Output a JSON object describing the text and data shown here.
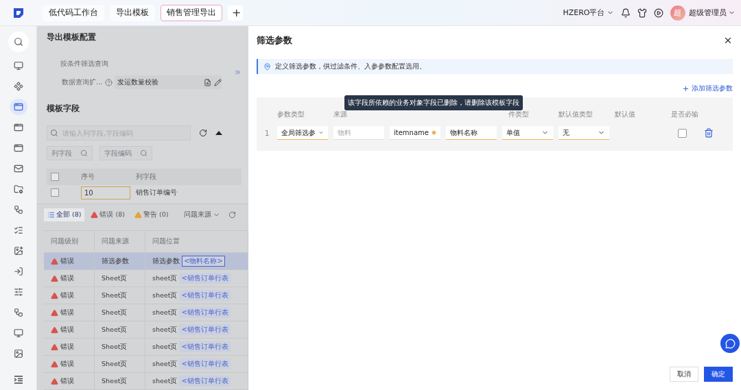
{
  "top_bar": {
    "tabs": [
      {
        "label": "低代码工作台",
        "selected": false
      },
      {
        "label": "导出模板",
        "selected": false
      },
      {
        "label": "销售管理导出",
        "selected": true
      }
    ],
    "add_tab": "+",
    "platform": "HZERO平台",
    "user": {
      "avatar": "超",
      "name": "超级管理员"
    }
  },
  "sidebar": {
    "items": [
      {
        "selected": false
      },
      {
        "selected": false
      },
      {
        "selected": true
      },
      {
        "selected": false
      },
      {
        "selected": false
      },
      {
        "selected": false
      },
      {
        "selected": false
      },
      {
        "selected": false
      },
      {
        "selected": false
      },
      {
        "selected": false
      },
      {
        "selected": false
      },
      {
        "selected": false
      },
      {
        "selected": false
      },
      {
        "selected": false
      },
      {
        "selected": false
      }
    ]
  },
  "config_panel": {
    "title": "导出模板配置",
    "query_mode": "按条件筛选查询",
    "extension": {
      "label": "数据查询扩...",
      "value": "发运数量校验"
    },
    "fields_title": "模板字段",
    "search": {
      "placeholder": "请输入列字段,字段编码"
    },
    "filters": [
      "列字段",
      "字段编码"
    ],
    "table": {
      "all_checked": false,
      "columns": [
        "序号",
        "列字段"
      ],
      "rows": [
        {
          "checked": false,
          "seq": "10",
          "field": "销售订单编号"
        }
      ]
    }
  },
  "issues": {
    "tabs": [
      {
        "kind": "all",
        "label": "全部 (8)",
        "selected": true
      },
      {
        "kind": "error",
        "label": "错误 (8)",
        "selected": false
      },
      {
        "kind": "warning",
        "label": "警告 (0)",
        "selected": false
      }
    ],
    "source_filter": "问题来源",
    "columns": [
      "问题级别",
      "问题来源",
      "问题位置"
    ],
    "rows": [
      {
        "kind": "error",
        "level": "错误",
        "source": "筛选参数",
        "location": "筛选参数",
        "tag": "<物料名称>",
        "selected": true
      },
      {
        "kind": "error",
        "level": "错误",
        "source": "Sheet页",
        "location": "sheet页",
        "tag": "<销售订单行表",
        "selected": false
      },
      {
        "kind": "error",
        "level": "错误",
        "source": "Sheet页",
        "location": "sheet页",
        "tag": "<销售订单行表",
        "selected": false
      },
      {
        "kind": "error",
        "level": "错误",
        "source": "Sheet页",
        "location": "sheet页",
        "tag": "<销售订单行表",
        "selected": false
      },
      {
        "kind": "error",
        "level": "错误",
        "source": "Sheet页",
        "location": "sheet页",
        "tag": "<销售订单行表",
        "selected": false
      },
      {
        "kind": "error",
        "level": "错误",
        "source": "Sheet页",
        "location": "sheet页",
        "tag": "<销售订单行表",
        "selected": false
      },
      {
        "kind": "error",
        "level": "错误",
        "source": "Sheet页",
        "location": "sheet页",
        "tag": "<销售订单行表",
        "selected": false
      },
      {
        "kind": "error",
        "level": "错误",
        "source": "Sheet页",
        "location": "sheet页",
        "tag": "<销售订单行表",
        "selected": false
      }
    ]
  },
  "drawer": {
    "title": "筛选参数",
    "info": "定义筛选参数，供过滤条件、入参参数配置选用。",
    "add_button": "添加筛选参数",
    "headers": {
      "param_type": "参数类型",
      "source": "来源",
      "condition_type": "件类型",
      "default_type": "默认值类型",
      "default_value": "默认值",
      "required": "是否必输"
    },
    "tooltip": "该字段所依赖的业务对象字段已删除，请删除该模板字段",
    "rows": [
      {
        "index": "1",
        "cells": [
          {
            "kind": "select",
            "value": "全局筛选参",
            "required": true,
            "warning": false
          },
          {
            "kind": "readonly",
            "placeholder": "物料",
            "required": false
          },
          {
            "kind": "text",
            "value": "itemname",
            "required": false,
            "warning": true
          },
          {
            "kind": "text",
            "value": "物料名称",
            "required": true,
            "warning": false
          },
          {
            "kind": "select",
            "value": "单值",
            "required": true,
            "warning": false
          },
          {
            "kind": "select",
            "value": "无",
            "required": true,
            "warning": false
          }
        ],
        "required_checked": false
      }
    ],
    "footer": {
      "cancel": "取消",
      "ok": "确定"
    }
  }
}
